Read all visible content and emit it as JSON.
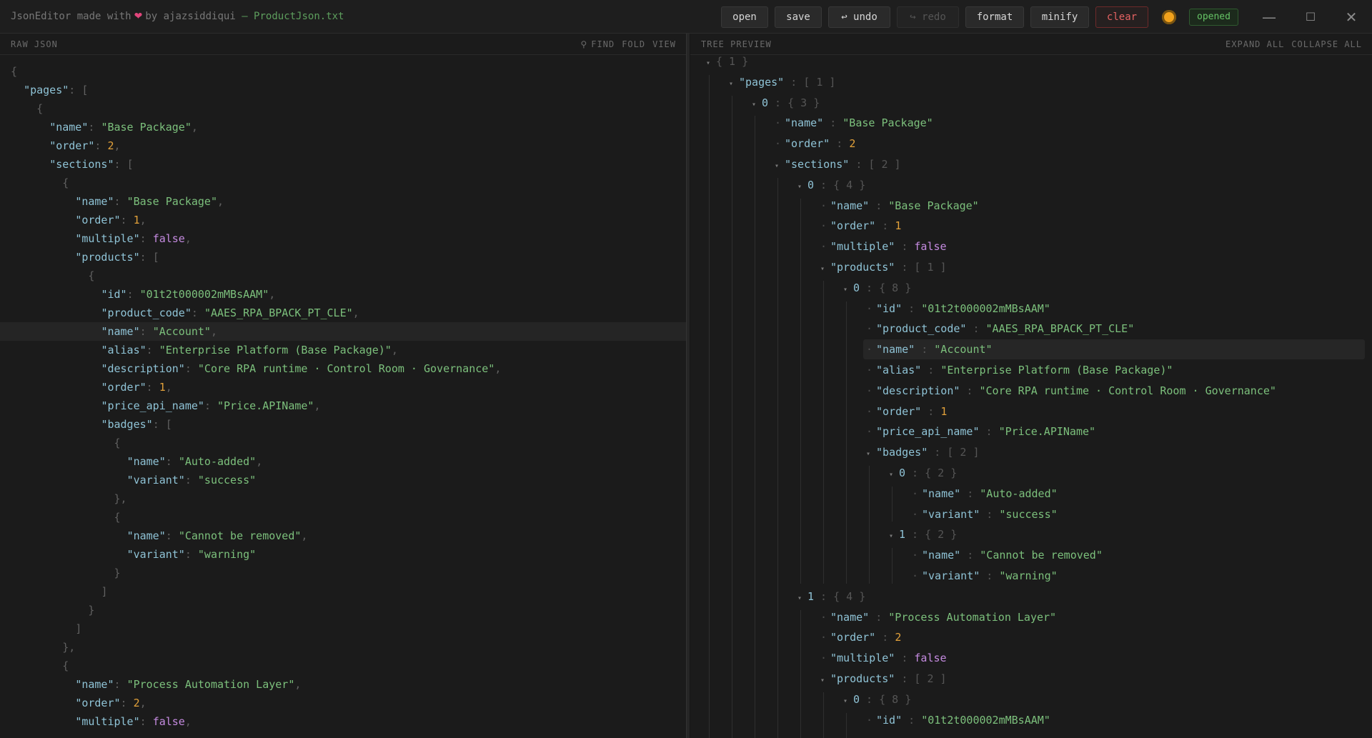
{
  "window": {
    "app": "JsonEditor made with",
    "by": "by ajazsiddiqui",
    "file": "— ProductJson.txt",
    "status": "opened"
  },
  "toolbar": {
    "open": "open",
    "save": "save",
    "undo": "↩ undo",
    "redo": "↪ redo",
    "format": "format",
    "minify": "minify",
    "clear": "clear"
  },
  "left_pane": {
    "title": "RAW JSON",
    "find": "FIND",
    "fold": "FOLD",
    "view": "VIEW"
  },
  "right_pane": {
    "title": "TREE PREVIEW",
    "expand": "EXPAND ALL",
    "collapse": "COLLAPSE ALL"
  },
  "raw_lines": [
    "{",
    "  \"pages\": [",
    "    {",
    "      \"name\": \"Base Package\",",
    "      \"order\": 2,",
    "      \"sections\": [",
    "        {",
    "          \"name\": \"Base Package\",",
    "          \"order\": 1,",
    "          \"multiple\": false,",
    "          \"products\": [",
    "            {",
    "              \"id\": \"01t2t000002mMBsAAM\",",
    "              \"product_code\": \"AAES_RPA_BPACK_PT_CLE\",",
    "              \"name\": \"Account\",",
    "              \"alias\": \"Enterprise Platform (Base Package)\",",
    "              \"description\": \"Core RPA runtime · Control Room · Governance\",",
    "              \"order\": 1,",
    "              \"price_api_name\": \"Price.APIName\",",
    "              \"badges\": [",
    "                {",
    "                  \"name\": \"Auto-added\",",
    "                  \"variant\": \"success\"",
    "                },",
    "                {",
    "                  \"name\": \"Cannot be removed\",",
    "                  \"variant\": \"warning\"",
    "                }",
    "              ]",
    "            }",
    "          ]",
    "        },",
    "        {",
    "          \"name\": \"Process Automation Layer\",",
    "          \"order\": 2,",
    "          \"multiple\": false,"
  ],
  "tree_nodes": [
    {
      "d": 0,
      "t": "obj",
      "k": "",
      "c": "{ 1 }"
    },
    {
      "d": 1,
      "t": "arr",
      "k": "\"pages\"",
      "c": "[ 1 ]"
    },
    {
      "d": 2,
      "t": "idx",
      "k": "0",
      "c": "{ 3 }"
    },
    {
      "d": 3,
      "t": "str",
      "k": "\"name\"",
      "v": "\"Base Package\""
    },
    {
      "d": 3,
      "t": "num",
      "k": "\"order\"",
      "v": "2"
    },
    {
      "d": 3,
      "t": "arr",
      "k": "\"sections\"",
      "c": "[ 2 ]"
    },
    {
      "d": 4,
      "t": "idx",
      "k": "0",
      "c": "{ 4 }"
    },
    {
      "d": 5,
      "t": "str",
      "k": "\"name\"",
      "v": "\"Base Package\""
    },
    {
      "d": 5,
      "t": "num",
      "k": "\"order\"",
      "v": "1"
    },
    {
      "d": 5,
      "t": "bool",
      "k": "\"multiple\"",
      "v": "false"
    },
    {
      "d": 5,
      "t": "arr",
      "k": "\"products\"",
      "c": "[ 1 ]"
    },
    {
      "d": 6,
      "t": "idx",
      "k": "0",
      "c": "{ 8 }"
    },
    {
      "d": 7,
      "t": "str",
      "k": "\"id\"",
      "v": "\"01t2t000002mMBsAAM\""
    },
    {
      "d": 7,
      "t": "str",
      "k": "\"product_code\"",
      "v": "\"AAES_RPA_BPACK_PT_CLE\""
    },
    {
      "d": 7,
      "t": "str",
      "k": "\"name\"",
      "v": "\"Account\"",
      "hl": true
    },
    {
      "d": 7,
      "t": "str",
      "k": "\"alias\"",
      "v": "\"Enterprise Platform (Base Package)\""
    },
    {
      "d": 7,
      "t": "str",
      "k": "\"description\"",
      "v": "\"Core RPA runtime · Control Room · Governance\""
    },
    {
      "d": 7,
      "t": "num",
      "k": "\"order\"",
      "v": "1"
    },
    {
      "d": 7,
      "t": "str",
      "k": "\"price_api_name\"",
      "v": "\"Price.APIName\""
    },
    {
      "d": 7,
      "t": "arr",
      "k": "\"badges\"",
      "c": "[ 2 ]"
    },
    {
      "d": 8,
      "t": "idx",
      "k": "0",
      "c": "{ 2 }"
    },
    {
      "d": 9,
      "t": "str",
      "k": "\"name\"",
      "v": "\"Auto-added\""
    },
    {
      "d": 9,
      "t": "str",
      "k": "\"variant\"",
      "v": "\"success\""
    },
    {
      "d": 8,
      "t": "idx",
      "k": "1",
      "c": "{ 2 }"
    },
    {
      "d": 9,
      "t": "str",
      "k": "\"name\"",
      "v": "\"Cannot be removed\""
    },
    {
      "d": 9,
      "t": "str",
      "k": "\"variant\"",
      "v": "\"warning\""
    },
    {
      "d": 4,
      "t": "idx",
      "k": "1",
      "c": "{ 4 }"
    },
    {
      "d": 5,
      "t": "str",
      "k": "\"name\"",
      "v": "\"Process Automation Layer\""
    },
    {
      "d": 5,
      "t": "num",
      "k": "\"order\"",
      "v": "2"
    },
    {
      "d": 5,
      "t": "bool",
      "k": "\"multiple\"",
      "v": "false"
    },
    {
      "d": 5,
      "t": "arr",
      "k": "\"products\"",
      "c": "[ 2 ]"
    },
    {
      "d": 6,
      "t": "idx",
      "k": "0",
      "c": "{ 8 }"
    },
    {
      "d": 7,
      "t": "str",
      "k": "\"id\"",
      "v": "\"01t2t000002mMBsAAM\""
    }
  ],
  "colors": {
    "key": "#8fc3d6",
    "string": "#7cc07c",
    "number": "#e2a13a",
    "boolean": "#c58be0",
    "status": "#66c466",
    "danger": "#e46262"
  }
}
